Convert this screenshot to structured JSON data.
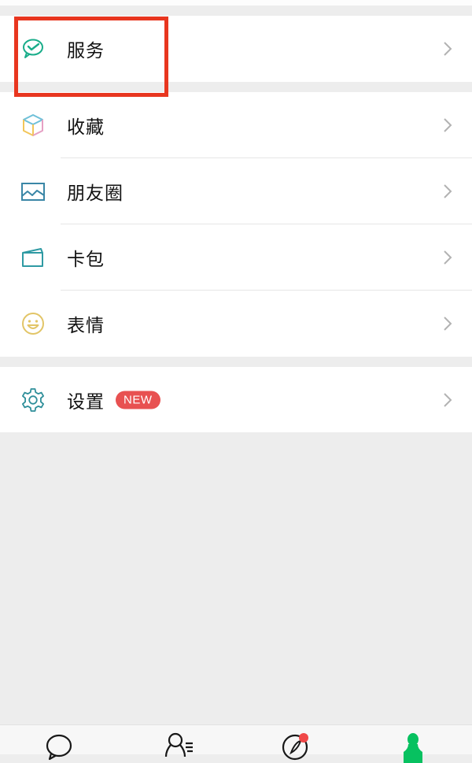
{
  "menu": {
    "groups": [
      {
        "items": [
          {
            "id": "services",
            "label": "服务",
            "icon": "wechat-pay-check-bubble-icon",
            "icon_color": "#1aad8a",
            "highlighted": true
          }
        ]
      },
      {
        "items": [
          {
            "id": "favorites",
            "label": "收藏",
            "icon": "cube-icon",
            "icon_colors": [
              "#6ec0d8",
              "#e6a0c4",
              "#f2c65a"
            ]
          },
          {
            "id": "moments",
            "label": "朋友圈",
            "icon": "photo-landscape-icon",
            "icon_color": "#3a86a6"
          },
          {
            "id": "cards",
            "label": "卡包",
            "icon": "wallet-card-icon",
            "icon_color": "#2f9aa3"
          },
          {
            "id": "stickers",
            "label": "表情",
            "icon": "smiley-face-icon",
            "icon_color": "#e2c567"
          }
        ]
      },
      {
        "items": [
          {
            "id": "settings",
            "label": "设置",
            "icon": "gear-icon",
            "icon_color": "#2f8f9a",
            "badge": "NEW"
          }
        ]
      }
    ]
  },
  "highlight_color": "#e8361f",
  "badge_color": "#e85151",
  "tabbar": {
    "tabs": [
      {
        "id": "chats",
        "icon": "chat-bubble-icon",
        "active": false
      },
      {
        "id": "contacts",
        "icon": "contacts-icon",
        "active": false
      },
      {
        "id": "discover",
        "icon": "compass-icon",
        "active": false,
        "dot": true
      },
      {
        "id": "me",
        "icon": "person-icon",
        "active": true,
        "active_color": "#07c160"
      }
    ]
  }
}
